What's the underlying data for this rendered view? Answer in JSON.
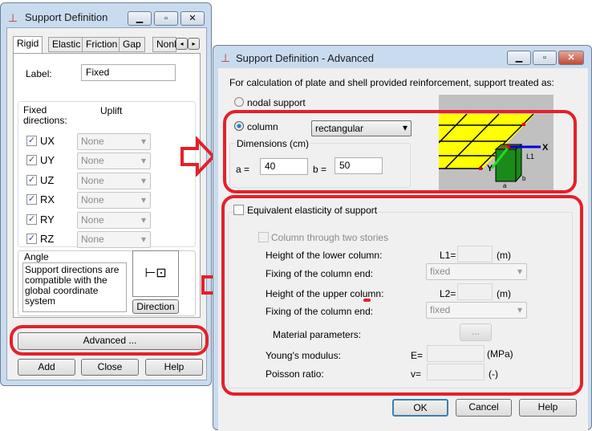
{
  "left": {
    "title": "Support Definition",
    "tabs": [
      "Rigid",
      "Elastic",
      "Friction",
      "Gap",
      "Nonl"
    ],
    "label_caption": "Label:",
    "label_value": "Fixed",
    "fixed_caption": "Fixed directions:",
    "uplift_caption": "Uplift",
    "directions": [
      {
        "name": "UX",
        "checked": true,
        "uplift": "None"
      },
      {
        "name": "UY",
        "checked": true,
        "uplift": "None"
      },
      {
        "name": "UZ",
        "checked": true,
        "uplift": "None"
      },
      {
        "name": "RX",
        "checked": true,
        "uplift": "None"
      },
      {
        "name": "RY",
        "checked": true,
        "uplift": "None"
      },
      {
        "name": "RZ",
        "checked": true,
        "uplift": "None"
      }
    ],
    "angle_caption": "Angle",
    "angle_text": "Support directions are compatible with the global coordinate system",
    "direction_button": "Direction",
    "advanced_button": "Advanced ...",
    "add_button": "Add",
    "close_button": "Close",
    "help_button": "Help"
  },
  "right": {
    "title": "Support Definition - Advanced",
    "intro": "For calculation of plate and shell provided reinforcement, support treated as:",
    "nodal_support": "nodal support",
    "column": "column",
    "column_selected": true,
    "shape": "rectangular",
    "dimensions_caption": "Dimensions (cm)",
    "a_label": "a =",
    "a_value": "40",
    "b_label": "b =",
    "b_value": "50",
    "diagram": {
      "x": "X",
      "y": "Y",
      "l1": "L1",
      "a": "a",
      "b": "b"
    },
    "equiv": "Equivalent elasticity of support",
    "two_stories": "Column through two stories",
    "lower_height": "Height of the lower column:",
    "l1_label": "L1=",
    "unit_m": "(m)",
    "fixing": "Fixing of the column end:",
    "fixing_value": "fixed",
    "upper_height": "Height of the upper column:",
    "l2_label": "L2=",
    "material": "Material parameters:",
    "material_button": "...",
    "young": "Young's modulus:",
    "e_label": "E=",
    "unit_mpa": "(MPa)",
    "poisson": "Poisson ratio:",
    "v_label": "v=",
    "unit_none": "(-)",
    "ok": "OK",
    "cancel": "Cancel",
    "help": "Help"
  },
  "colors": {
    "annotation": "#e4202a",
    "slab": "#ffff00",
    "column": "#1a8a1a"
  }
}
